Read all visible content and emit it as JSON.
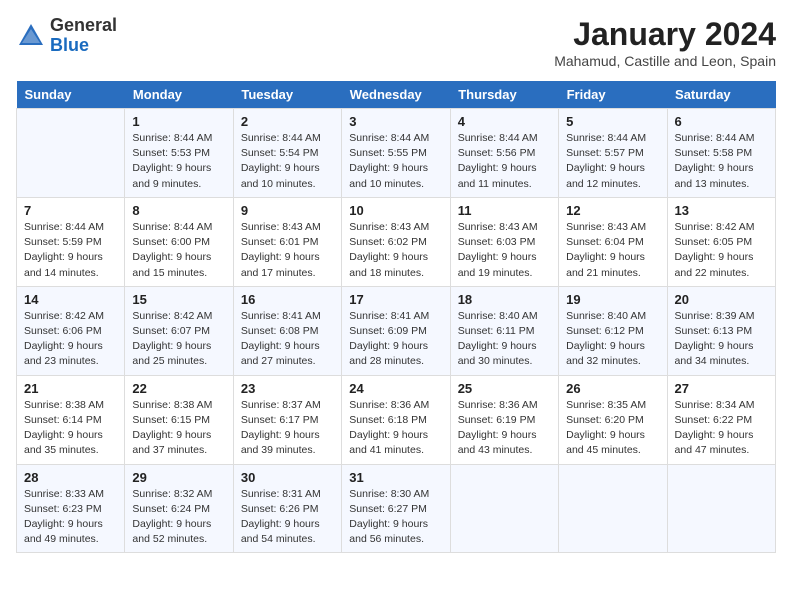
{
  "header": {
    "logo_general": "General",
    "logo_blue": "Blue",
    "month_year": "January 2024",
    "location": "Mahamud, Castille and Leon, Spain"
  },
  "days_of_week": [
    "Sunday",
    "Monday",
    "Tuesday",
    "Wednesday",
    "Thursday",
    "Friday",
    "Saturday"
  ],
  "weeks": [
    [
      {
        "day": "",
        "sunrise": "",
        "sunset": "",
        "daylight": ""
      },
      {
        "day": "1",
        "sunrise": "Sunrise: 8:44 AM",
        "sunset": "Sunset: 5:53 PM",
        "daylight": "Daylight: 9 hours and 9 minutes."
      },
      {
        "day": "2",
        "sunrise": "Sunrise: 8:44 AM",
        "sunset": "Sunset: 5:54 PM",
        "daylight": "Daylight: 9 hours and 10 minutes."
      },
      {
        "day": "3",
        "sunrise": "Sunrise: 8:44 AM",
        "sunset": "Sunset: 5:55 PM",
        "daylight": "Daylight: 9 hours and 10 minutes."
      },
      {
        "day": "4",
        "sunrise": "Sunrise: 8:44 AM",
        "sunset": "Sunset: 5:56 PM",
        "daylight": "Daylight: 9 hours and 11 minutes."
      },
      {
        "day": "5",
        "sunrise": "Sunrise: 8:44 AM",
        "sunset": "Sunset: 5:57 PM",
        "daylight": "Daylight: 9 hours and 12 minutes."
      },
      {
        "day": "6",
        "sunrise": "Sunrise: 8:44 AM",
        "sunset": "Sunset: 5:58 PM",
        "daylight": "Daylight: 9 hours and 13 minutes."
      }
    ],
    [
      {
        "day": "7",
        "sunrise": "Sunrise: 8:44 AM",
        "sunset": "Sunset: 5:59 PM",
        "daylight": "Daylight: 9 hours and 14 minutes."
      },
      {
        "day": "8",
        "sunrise": "Sunrise: 8:44 AM",
        "sunset": "Sunset: 6:00 PM",
        "daylight": "Daylight: 9 hours and 15 minutes."
      },
      {
        "day": "9",
        "sunrise": "Sunrise: 8:43 AM",
        "sunset": "Sunset: 6:01 PM",
        "daylight": "Daylight: 9 hours and 17 minutes."
      },
      {
        "day": "10",
        "sunrise": "Sunrise: 8:43 AM",
        "sunset": "Sunset: 6:02 PM",
        "daylight": "Daylight: 9 hours and 18 minutes."
      },
      {
        "day": "11",
        "sunrise": "Sunrise: 8:43 AM",
        "sunset": "Sunset: 6:03 PM",
        "daylight": "Daylight: 9 hours and 19 minutes."
      },
      {
        "day": "12",
        "sunrise": "Sunrise: 8:43 AM",
        "sunset": "Sunset: 6:04 PM",
        "daylight": "Daylight: 9 hours and 21 minutes."
      },
      {
        "day": "13",
        "sunrise": "Sunrise: 8:42 AM",
        "sunset": "Sunset: 6:05 PM",
        "daylight": "Daylight: 9 hours and 22 minutes."
      }
    ],
    [
      {
        "day": "14",
        "sunrise": "Sunrise: 8:42 AM",
        "sunset": "Sunset: 6:06 PM",
        "daylight": "Daylight: 9 hours and 23 minutes."
      },
      {
        "day": "15",
        "sunrise": "Sunrise: 8:42 AM",
        "sunset": "Sunset: 6:07 PM",
        "daylight": "Daylight: 9 hours and 25 minutes."
      },
      {
        "day": "16",
        "sunrise": "Sunrise: 8:41 AM",
        "sunset": "Sunset: 6:08 PM",
        "daylight": "Daylight: 9 hours and 27 minutes."
      },
      {
        "day": "17",
        "sunrise": "Sunrise: 8:41 AM",
        "sunset": "Sunset: 6:09 PM",
        "daylight": "Daylight: 9 hours and 28 minutes."
      },
      {
        "day": "18",
        "sunrise": "Sunrise: 8:40 AM",
        "sunset": "Sunset: 6:11 PM",
        "daylight": "Daylight: 9 hours and 30 minutes."
      },
      {
        "day": "19",
        "sunrise": "Sunrise: 8:40 AM",
        "sunset": "Sunset: 6:12 PM",
        "daylight": "Daylight: 9 hours and 32 minutes."
      },
      {
        "day": "20",
        "sunrise": "Sunrise: 8:39 AM",
        "sunset": "Sunset: 6:13 PM",
        "daylight": "Daylight: 9 hours and 34 minutes."
      }
    ],
    [
      {
        "day": "21",
        "sunrise": "Sunrise: 8:38 AM",
        "sunset": "Sunset: 6:14 PM",
        "daylight": "Daylight: 9 hours and 35 minutes."
      },
      {
        "day": "22",
        "sunrise": "Sunrise: 8:38 AM",
        "sunset": "Sunset: 6:15 PM",
        "daylight": "Daylight: 9 hours and 37 minutes."
      },
      {
        "day": "23",
        "sunrise": "Sunrise: 8:37 AM",
        "sunset": "Sunset: 6:17 PM",
        "daylight": "Daylight: 9 hours and 39 minutes."
      },
      {
        "day": "24",
        "sunrise": "Sunrise: 8:36 AM",
        "sunset": "Sunset: 6:18 PM",
        "daylight": "Daylight: 9 hours and 41 minutes."
      },
      {
        "day": "25",
        "sunrise": "Sunrise: 8:36 AM",
        "sunset": "Sunset: 6:19 PM",
        "daylight": "Daylight: 9 hours and 43 minutes."
      },
      {
        "day": "26",
        "sunrise": "Sunrise: 8:35 AM",
        "sunset": "Sunset: 6:20 PM",
        "daylight": "Daylight: 9 hours and 45 minutes."
      },
      {
        "day": "27",
        "sunrise": "Sunrise: 8:34 AM",
        "sunset": "Sunset: 6:22 PM",
        "daylight": "Daylight: 9 hours and 47 minutes."
      }
    ],
    [
      {
        "day": "28",
        "sunrise": "Sunrise: 8:33 AM",
        "sunset": "Sunset: 6:23 PM",
        "daylight": "Daylight: 9 hours and 49 minutes."
      },
      {
        "day": "29",
        "sunrise": "Sunrise: 8:32 AM",
        "sunset": "Sunset: 6:24 PM",
        "daylight": "Daylight: 9 hours and 52 minutes."
      },
      {
        "day": "30",
        "sunrise": "Sunrise: 8:31 AM",
        "sunset": "Sunset: 6:26 PM",
        "daylight": "Daylight: 9 hours and 54 minutes."
      },
      {
        "day": "31",
        "sunrise": "Sunrise: 8:30 AM",
        "sunset": "Sunset: 6:27 PM",
        "daylight": "Daylight: 9 hours and 56 minutes."
      },
      {
        "day": "",
        "sunrise": "",
        "sunset": "",
        "daylight": ""
      },
      {
        "day": "",
        "sunrise": "",
        "sunset": "",
        "daylight": ""
      },
      {
        "day": "",
        "sunrise": "",
        "sunset": "",
        "daylight": ""
      }
    ]
  ]
}
